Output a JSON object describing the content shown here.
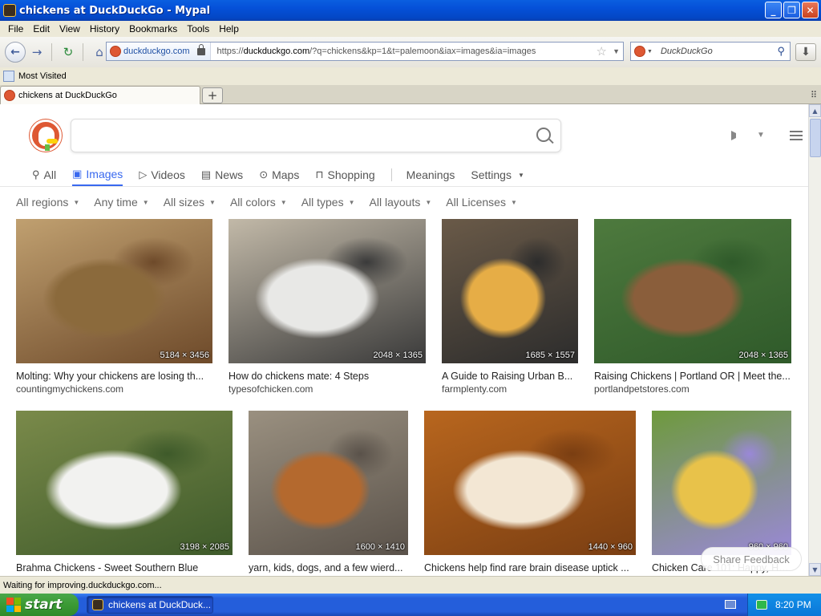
{
  "window": {
    "title": "chickens at DuckDuckGo - Mypal",
    "buttons": [
      "minimize",
      "maximize",
      "close"
    ]
  },
  "menubar": [
    "File",
    "Edit",
    "View",
    "History",
    "Bookmarks",
    "Tools",
    "Help"
  ],
  "navbar": {
    "identity": "duckduckgo.com",
    "url_prefix": "https://",
    "url_host": "duckduckgo.com",
    "url_rest": "/?q=chickens&kp=1&t=palemoon&iax=images&ia=images",
    "search_placeholder": "DuckDuckGo"
  },
  "bookmarks": {
    "most_visited": "Most Visited"
  },
  "tabstrip": {
    "active_tab": "chickens at DuckDuckGo",
    "new_tab": "+"
  },
  "ddg": {
    "search_value": "",
    "tabs": [
      {
        "label": "All",
        "icon": "search-icon"
      },
      {
        "label": "Images",
        "icon": "image-icon"
      },
      {
        "label": "Videos",
        "icon": "play-icon"
      },
      {
        "label": "News",
        "icon": "news-icon"
      },
      {
        "label": "Maps",
        "icon": "map-pin-icon"
      },
      {
        "label": "Shopping",
        "icon": "bag-icon"
      },
      {
        "label": "Meanings",
        "icon": ""
      },
      {
        "label": "Settings",
        "icon": ""
      }
    ],
    "filters": [
      "All regions",
      "Any time",
      "All sizes",
      "All colors",
      "All types",
      "All layouts",
      "All Licenses"
    ],
    "results": [
      {
        "caption": "Molting: Why your chickens are losing th...",
        "site": "countingmychickens.com",
        "dims": "5184 × 3456",
        "colors": [
          "#8b6a3c",
          "#c0a070",
          "#6e4a2a"
        ]
      },
      {
        "caption": "How do chickens mate: 4 Steps",
        "site": "typesofchicken.com",
        "dims": "2048 × 1365",
        "colors": [
          "#e8e8e6",
          "#c2b9a8",
          "#3a3a3a"
        ]
      },
      {
        "caption": "A Guide to Raising Urban B...",
        "site": "farmplenty.com",
        "dims": "1685 × 1557",
        "colors": [
          "#e6ad46",
          "#6a5a48",
          "#2c2c2c"
        ]
      },
      {
        "caption": "Raising Chickens | Portland OR | Meet the...",
        "site": "portlandpetstores.com",
        "dims": "2048 × 1365",
        "colors": [
          "#8a5e3b",
          "#4e7a3e",
          "#2f5a2a"
        ]
      },
      {
        "caption": "Brahma Chickens - Sweet Southern Blue",
        "site": "",
        "dims": "3198 × 2085",
        "colors": [
          "#f2f2f0",
          "#7a8a4a",
          "#3e5a2a"
        ]
      },
      {
        "caption": "yarn, kids, dogs, and a few wierd...",
        "site": "",
        "dims": "1600 × 1410",
        "colors": [
          "#b4692e",
          "#9a9080",
          "#5a524a"
        ]
      },
      {
        "caption": "Chickens help find rare brain disease uptick ...",
        "site": "",
        "dims": "1440 × 960",
        "colors": [
          "#f3e7d4",
          "#b8661e",
          "#7a3e12"
        ]
      },
      {
        "caption": "Chicken Care 101: Happy, He...",
        "site": "",
        "dims": "960 × 960",
        "colors": [
          "#e8c24a",
          "#6e9a3c",
          "#9a88d8"
        ]
      }
    ],
    "share_feedback": "Share Feedback"
  },
  "statusbar": {
    "text": "Waiting for improving.duckduckgo.com..."
  },
  "taskbar": {
    "start": "start",
    "task_item": "chickens at DuckDuck...",
    "clock": "8:20 PM"
  }
}
